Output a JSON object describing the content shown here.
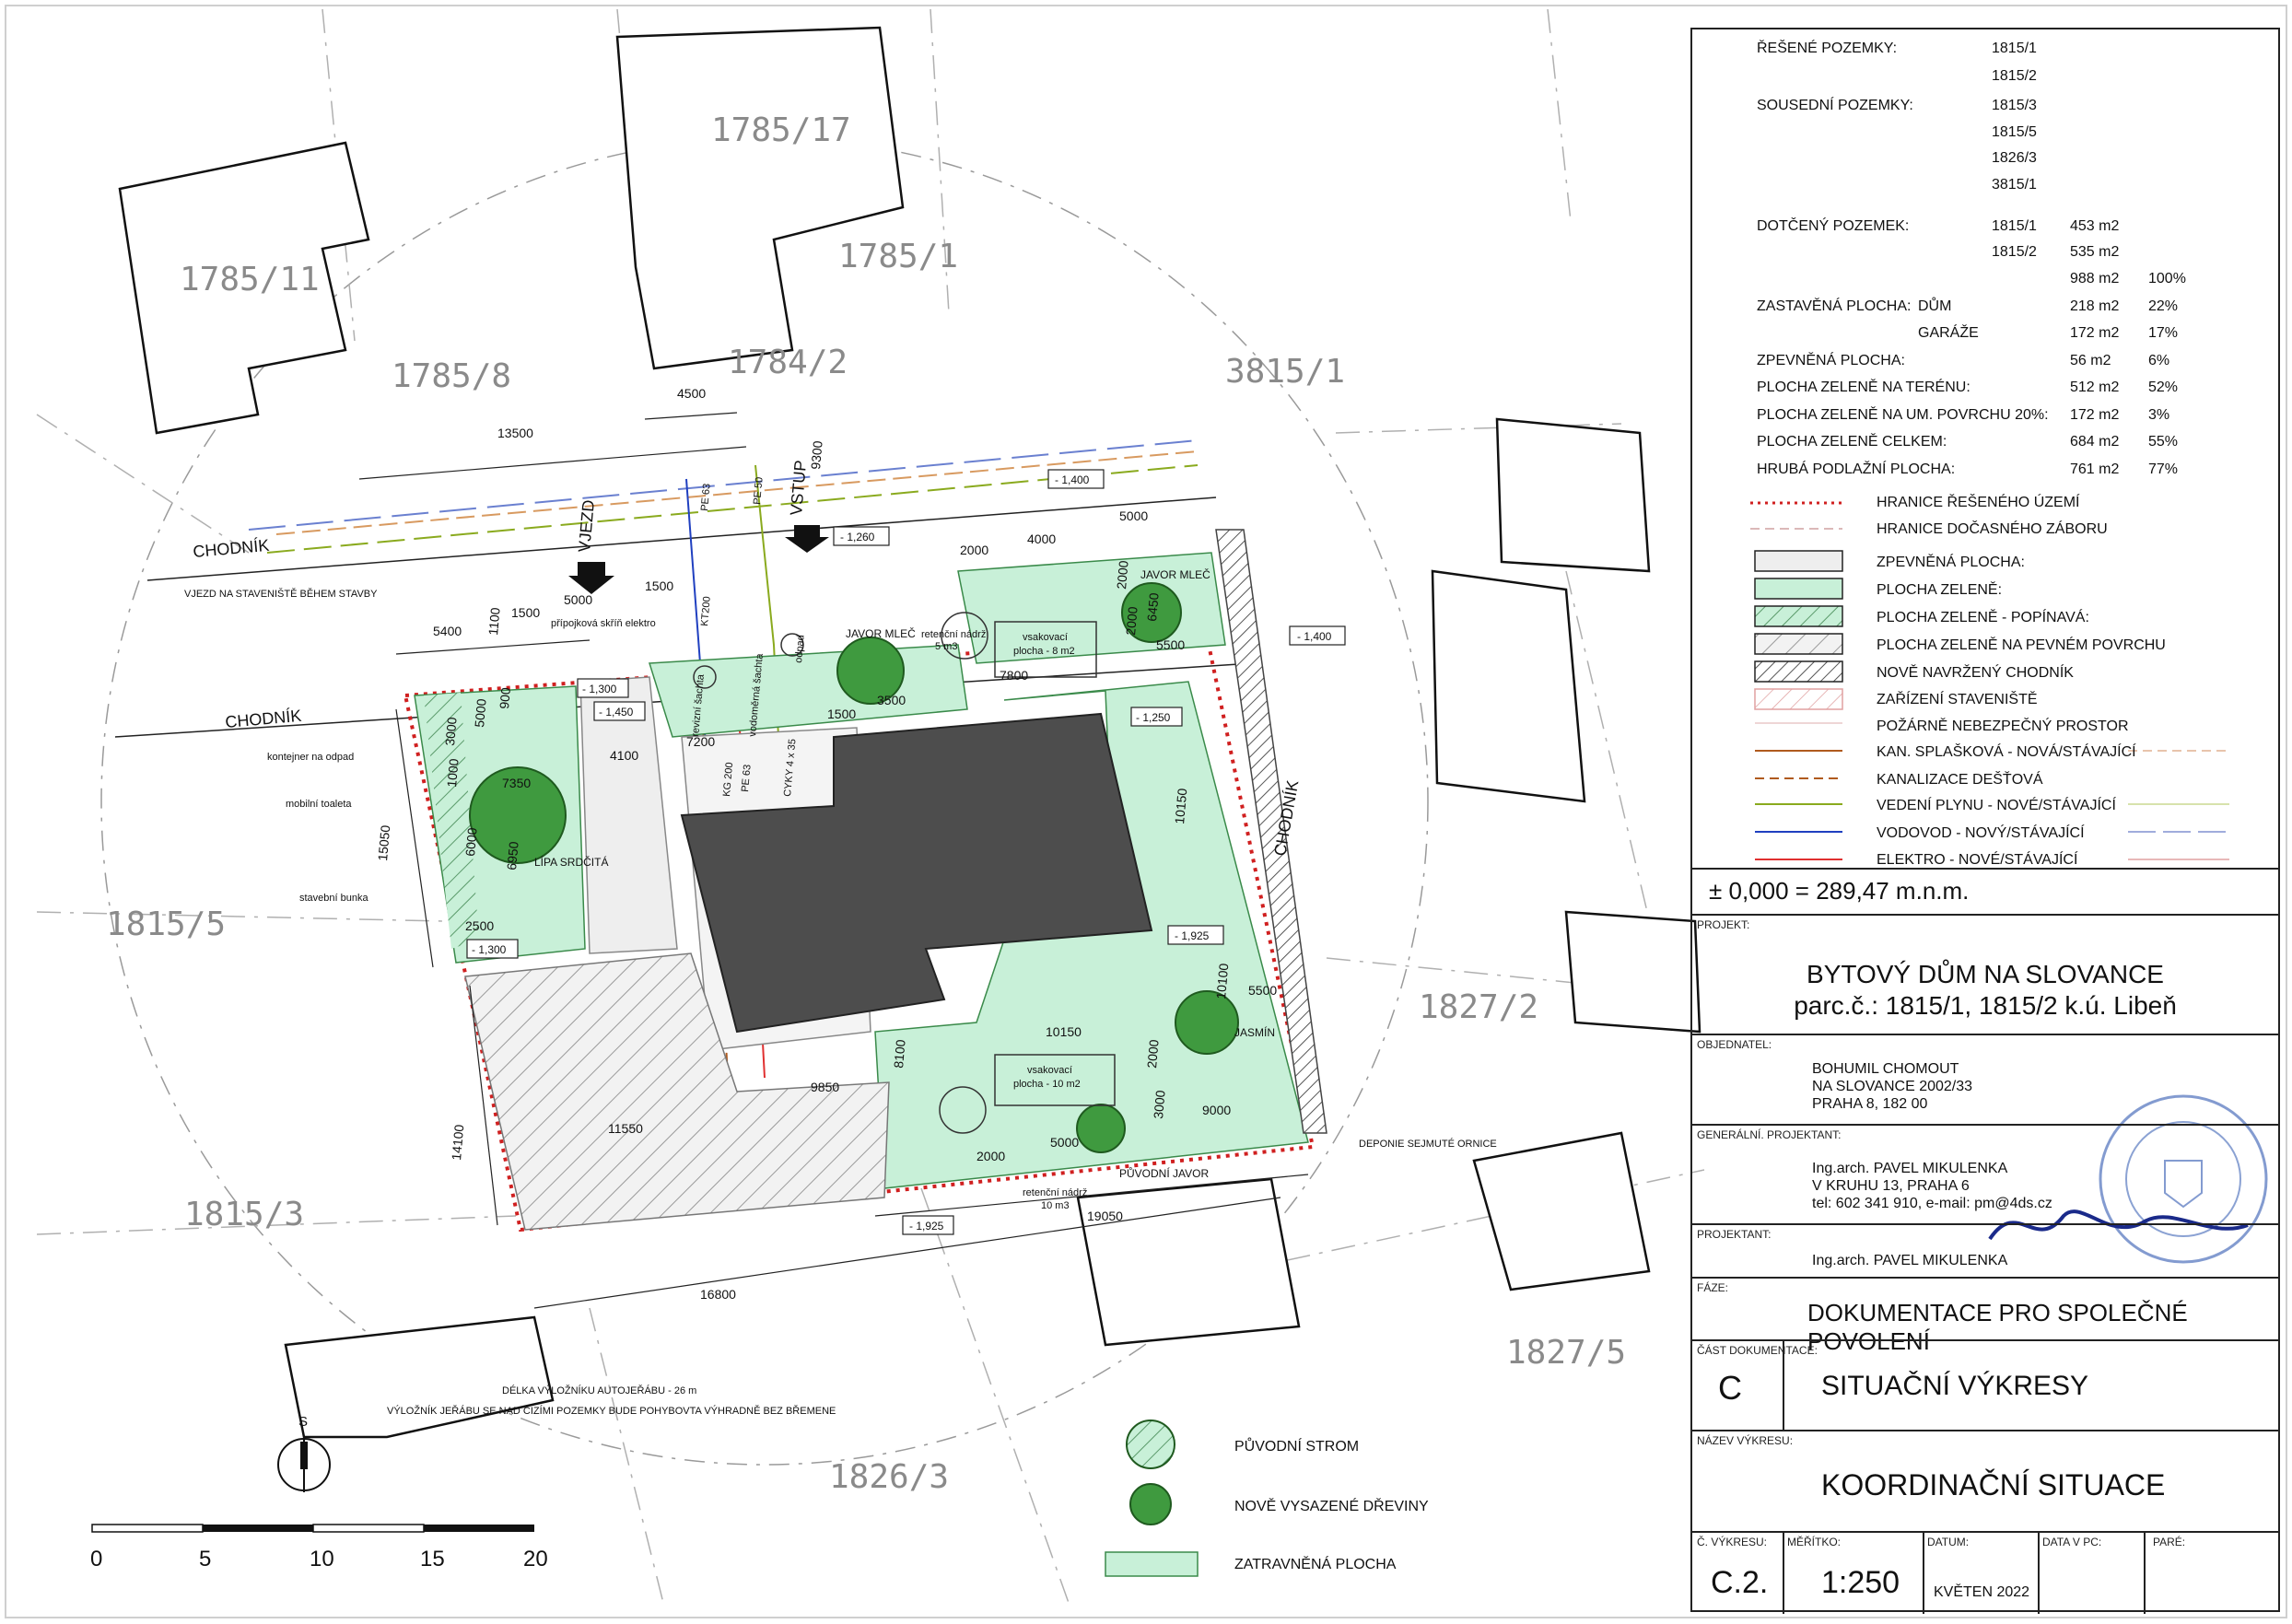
{
  "parcels": {
    "p1785_17": "1785/17",
    "p1785_11": "1785/11",
    "p1785_1": "1785/1",
    "p1785_8": "1785/8",
    "p1784_2": "1784/2",
    "p3815_1": "3815/1",
    "p1815_5": "1815/5",
    "p1815_3": "1815/3",
    "p1827_2": "1827/2",
    "p1827_5": "1827/5",
    "p1826_3": "1826/3"
  },
  "plan_labels": {
    "chodnik_top": "CHODNÍK",
    "chodnik_mid": "CHODNÍK",
    "chodnik_right": "CHODNÍK",
    "vjezd_staveniste": "VJEZD NA STAVENIŠTĚ BĚHEM STAVBY",
    "vjezd": "VJEZD",
    "vstup": "VSTUP",
    "kontejner": "kontejner na odpad",
    "mobilni_toaleta": "mobilní toaleta",
    "stavebni_bunka": "stavební bunka",
    "lipa": "LÍPA SRDČITÁ",
    "javor1": "JAVOR MLEČ",
    "javor2": "JAVOR MLEČ",
    "jasmin": "JASMÍN",
    "puvodni_javor": "PŮVODNÍ JAVOR",
    "deponie": "DEPONIE SEJMUTÉ ORNICE",
    "pripojkova": "přípojková skříň elektro",
    "retencni1_a": "retenční nádrž",
    "retencni1_b": "5 m3",
    "vsak1_a": "vsakovací",
    "vsak1_b": "plocha - 8 m2",
    "vsak2_a": "vsakovací",
    "vsak2_b": "plocha - 10 m2",
    "retencni2_a": "retenční nádrž",
    "retencni2_b": "10 m3",
    "revizni": "revizní šachta",
    "vodomerna": "vodoměrná šachta",
    "odpad": "odpad",
    "pe63": "PE 63",
    "pe50": "PE 50",
    "kt200": "KT200",
    "kg200": "KG 200",
    "pe63b": "PE 63",
    "cykv": "CYKY 4 x 35",
    "delka1": "DÉLKA VÝLOŽNÍKU AUTOJEŘÁBU - 26 m",
    "delka2": "VÝLOŽNÍK JEŘÁBU SE NAD CIZÍMI POZEMKY BUDE POHYBOVTA VÝHRADNĚ BEZ BŘEMENE",
    "north": "S"
  },
  "levels": [
    "- 1,400",
    "- 1,260",
    "- 1,400",
    "- 1,300",
    "- 1,450",
    "- 1,250",
    "- 1,925",
    "- 1,300",
    "- 1,925"
  ],
  "dims": {
    "d13500": "13500",
    "d4500": "4500",
    "d9300": "9300",
    "d5000a": "5000",
    "d5400": "5400",
    "d1100": "1100",
    "d1500a": "1500",
    "d5000b": "5000",
    "d1500b": "1500",
    "d2000a": "2000",
    "d4000": "4000",
    "d2000b": "2000",
    "d2000c": "2000",
    "d6450": "6450",
    "d5500a": "5500",
    "d7800": "7800",
    "d3500": "3500",
    "d1500c": "1500",
    "d7200": "7200",
    "d4100": "4100",
    "d3000a": "3000",
    "d5000c": "5000",
    "d900": "900",
    "d1000": "1000",
    "d7350": "7350",
    "d6000": "6000",
    "d6950": "6950",
    "d15050": "15050",
    "d2500": "2500",
    "d10150a": "10150",
    "d10100": "10100",
    "d5500b": "5500",
    "d10150b": "10150",
    "d8100": "8100",
    "d2000d": "2000",
    "d3000b": "3000",
    "d9850": "9850",
    "d11550": "11550",
    "d14100": "14100",
    "d9000": "9000",
    "d2000e": "2000",
    "d5000d": "5000",
    "d19050": "19050",
    "d16800": "16800"
  },
  "plant_legend": {
    "puvodni_strom": "PŮVODNÍ STROM",
    "nove_dreviny": "NOVĚ VYSAZENÉ DŘEVINY",
    "zatravnena": "ZATRAVNĚNÁ PLOCHA"
  },
  "scale_bar": [
    "0",
    "5",
    "10",
    "15",
    "20"
  ],
  "areas": {
    "reseny_label": "ŘEŠENÉ POZEMKY:",
    "reseny_1": "1815/1",
    "reseny_2": "1815/2",
    "sousedni_label": "SOUSEDNÍ POZEMKY:",
    "sousedni_1": "1815/3",
    "sousedni_2": "1815/5",
    "sousedni_3": "1826/3",
    "sousedni_4": "3815/1",
    "dotceny_label": "DOTČENÝ POZEMEK:",
    "dot_1_p": "1815/1",
    "dot_1_v": "453 m2",
    "dot_2_p": "1815/2",
    "dot_2_v": "535 m2",
    "dot_sum_v": "988 m2",
    "dot_sum_pct": "100%",
    "zast_label": "ZASTAVĚNÁ PLOCHA:",
    "zast_dum": "DŮM",
    "zast_dum_v": "218 m2",
    "zast_dum_pct": "22%",
    "zast_garaze": "GARÁŽE",
    "zast_garaze_v": "172 m2",
    "zast_garaze_pct": "17%",
    "zpev_label": "ZPEVNĚNÁ PLOCHA:",
    "zpev_v": "56 m2",
    "zpev_pct": "6%",
    "zel_teren_label": "PLOCHA ZELENĚ NA TERÉNU:",
    "zel_teren_v": "512 m2",
    "zel_teren_pct": "52%",
    "zel_um_label": "PLOCHA ZELENĚ NA UM. POVRCHU 20%:",
    "zel_um_v": "172 m2",
    "zel_um_pct": "3%",
    "zel_celk_label": "PLOCHA ZELENĚ CELKEM:",
    "zel_celk_v": "684 m2",
    "zel_celk_pct": "55%",
    "hpp_label": "HRUBÁ PODLAŽNÍ PLOCHA:",
    "hpp_v": "761 m2",
    "hpp_pct": "77%"
  },
  "legend": [
    "HRANICE ŘEŠENÉHO ÚZEMÍ",
    "HRANICE DOČASNÉHO ZÁBORU",
    "ZPEVNĚNÁ PLOCHA:",
    "PLOCHA ZELENĚ:",
    "PLOCHA ZELENĚ - POPÍNAVÁ:",
    "PLOCHA ZELENĚ NA PEVNÉM POVRCHU",
    "NOVĚ NAVRŽENÝ CHODNÍK",
    "ZAŘÍZENÍ STAVENIŠTĚ",
    "POŽÁRNĚ NEBEZPEČNÝ PROSTOR",
    "KAN. SPLAŠKOVÁ - NOVÁ/STÁVAJÍCÍ",
    "KANALIZACE DEŠŤOVÁ",
    "VEDENÍ PLYNU - NOVÉ/STÁVAJÍCÍ",
    "VODOVOD - NOVÝ/STÁVAJÍCÍ",
    "ELEKTRO - NOVÉ/STÁVAJÍCÍ"
  ],
  "title_block": {
    "elevation": "± 0,000 = 289,47 m.n.m.",
    "projekt_hdr": "PROJEKT:",
    "projekt_1": "BYTOVÝ DŮM NA SLOVANCE",
    "projekt_2": "parc.č.: 1815/1, 1815/2 k.ú. Libeň",
    "objednatel_hdr": "OBJEDNATEL:",
    "objednatel_1": "BOHUMIL CHOMOUT",
    "objednatel_2": "NA SLOVANCE 2002/33",
    "objednatel_3": "PRAHA 8, 182 00",
    "gen_hdr": "GENERÁLNÍ. PROJEKTANT:",
    "gen_1": "Ing.arch. PAVEL MIKULENKA",
    "gen_2": "V KRUHU 13, PRAHA 6",
    "gen_3": "tel: 602 341 910, e-mail: pm@4ds.cz",
    "projektant_hdr": "PROJEKTANT:",
    "projektant_1": "Ing.arch. PAVEL MIKULENKA",
    "faze_hdr": "FÁZE:",
    "faze": "DOKUMENTACE PRO SPOLEČNÉ POVOLENÍ",
    "cast_hdr": "ČÁST DOKUMENTACE:",
    "cast_code": "C",
    "cast_name": "SITUAČNÍ VÝKRESY",
    "nazev_hdr": "NÁZEV VÝKRESU:",
    "nazev": "KOORDINAČNÍ SITUACE",
    "cislo_hdr": "Č. VÝKRESU:",
    "meritko_hdr": "MĚŘÍTKO:",
    "datum_hdr": "DATUM:",
    "datavpc_hdr": "DATA V PC:",
    "pare_hdr": "PARÉ:",
    "cislo": "C.2.",
    "meritko": "1:250",
    "datum": "KVĚTEN 2022"
  },
  "colors": {
    "green": "#c8f0d8",
    "green_dark": "#3f9a3f",
    "building": "#4d4d4d",
    "boundary_red": "#d02020",
    "gas": "#8aaa1e",
    "water": "#2040c0",
    "sewer": "#b05a1e",
    "electric": "#e03030"
  }
}
